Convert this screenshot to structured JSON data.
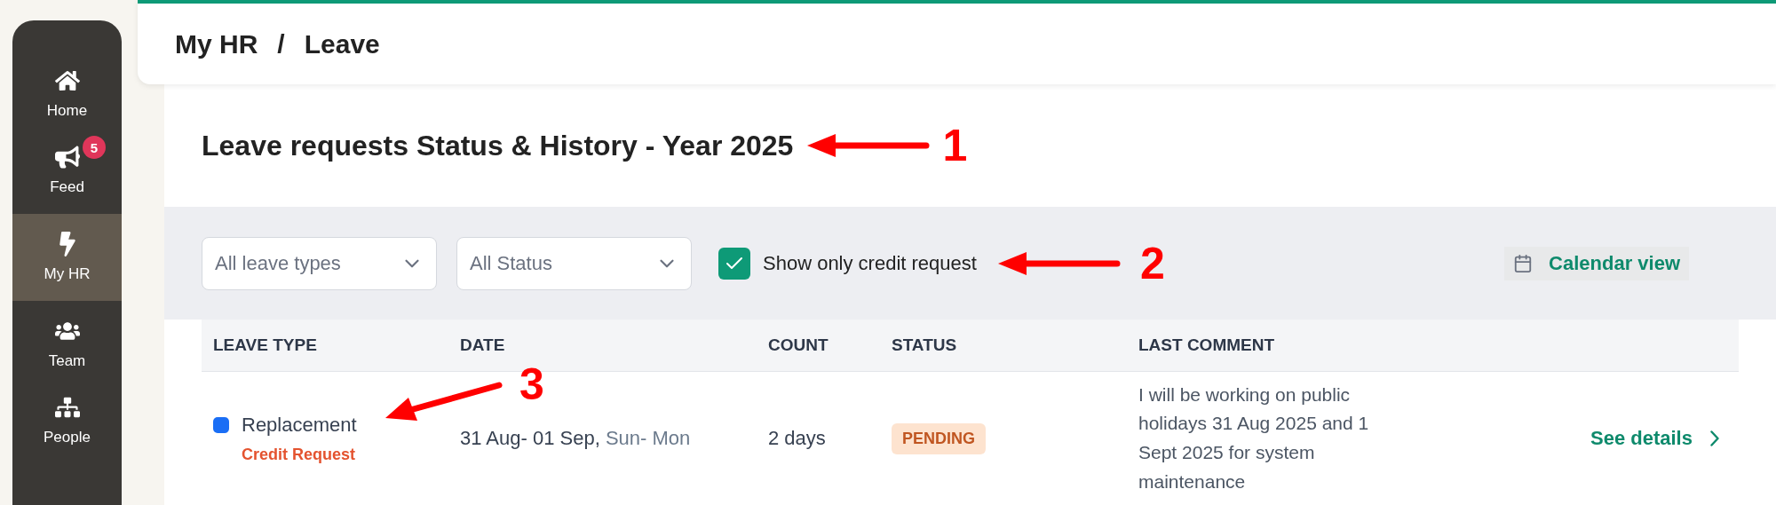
{
  "sidebar": {
    "items": [
      {
        "label": "Home",
        "selected": false
      },
      {
        "label": "Feed",
        "selected": false,
        "badge": "5"
      },
      {
        "label": "My HR",
        "selected": true
      },
      {
        "label": "Team",
        "selected": false
      },
      {
        "label": "People",
        "selected": false
      }
    ]
  },
  "breadcrumb": {
    "items": [
      "My HR",
      "Leave"
    ],
    "separator": "/"
  },
  "title": "Leave requests Status & History - Year 2025",
  "filters": {
    "leave_type": {
      "value": "All leave types"
    },
    "status": {
      "value": "All Status"
    },
    "credit_only": {
      "label": "Show only credit request",
      "checked": true
    },
    "calendar_link": "Calendar view"
  },
  "table": {
    "columns": [
      "LEAVE TYPE",
      "DATE",
      "COUNT",
      "STATUS",
      "LAST COMMENT"
    ],
    "rows": [
      {
        "leave_type": "Replacement",
        "color": "#1a6ef5",
        "tag": "Credit Request",
        "date": "31 Aug- 01 Sep,",
        "weekdays": "Sun- Mon",
        "count": "2 days",
        "status": {
          "label": "PENDING",
          "kind": "pending"
        },
        "comment": "I will be working on public holidays 31 Aug 2025 and 1 Sept 2025 for system maintenance",
        "action": "See details"
      }
    ]
  },
  "annotations": [
    {
      "label": "1"
    },
    {
      "label": "2"
    },
    {
      "label": "3"
    }
  ]
}
